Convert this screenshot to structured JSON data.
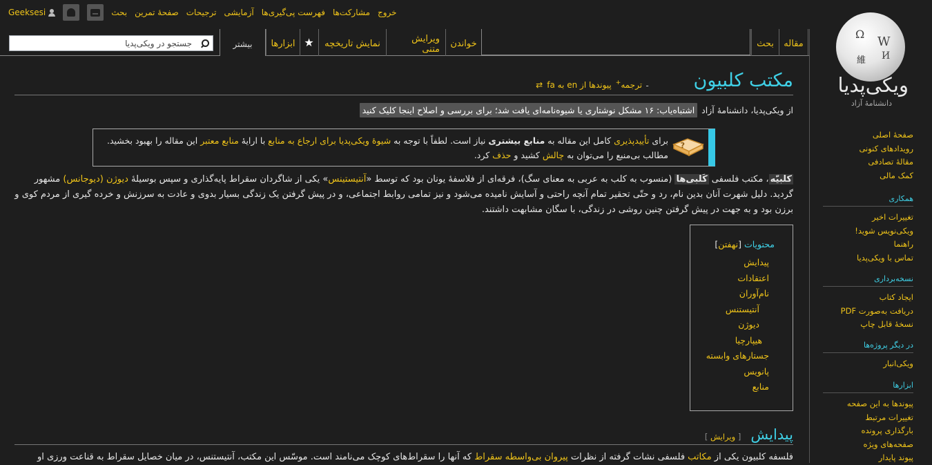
{
  "personal_tools": {
    "username": "Geeksesi",
    "talk": "بحث",
    "sandbox": "صفحهٔ تمرین",
    "preferences": "ترجیحات",
    "beta": "آزمایشی",
    "watchlist": "فهرست پی‌گیری‌ها",
    "contributions": "مشارکت‌ها",
    "logout": "خروج"
  },
  "search": {
    "placeholder": "جستجو در ویکی‌پدیا"
  },
  "tabs": {
    "article": "مقاله",
    "talk": "بحث",
    "read": "خواندن",
    "edit_source": "ویرایش متنی",
    "history": "نمایش تاریخچه",
    "watch_star": "★",
    "tools": "ابزارها",
    "more": "بیشتر"
  },
  "logo": {
    "wordmark": "ویکی‌پدیا",
    "tagline": "دانشنامهٔ آزاد"
  },
  "sidebar": {
    "navigation": [
      "صفحهٔ اصلی",
      "رویدادهای کنونی",
      "مقالهٔ تصادفی",
      "کمک مالی"
    ],
    "interaction": {
      "heading": "همکاری",
      "items": [
        "تغییرات اخیر",
        "ویکی‌نویس شوید!",
        "راهنما",
        "تماس با ویکی‌پدیا"
      ]
    },
    "print": {
      "heading": "نسخه‌برداری",
      "items": [
        "ایجاد کتاب",
        "دریافت به‌صورت PDF",
        "نسخهٔ قابل چاپ"
      ]
    },
    "projects": {
      "heading": "در دیگر پروژه‌ها",
      "items": [
        "ویکی‌انبار"
      ]
    },
    "tools": {
      "heading": "ابزارها",
      "items": [
        "پیوندها به این صفحه",
        "تغییرات مرتبط",
        "بارگذاری پرونده",
        "صفحه‌های ویژه",
        "پیوند پایدار"
      ]
    }
  },
  "article": {
    "title": "مکتب کلبیون",
    "translate": "ترجمه",
    "translate_sup": "+",
    "caret": "ـ",
    "lang_links": "پیوندها از en به fa",
    "lang_icon": "⇄",
    "site_sub": "از ویکی‌پدیا، دانشنامهٔ آزاد",
    "lint_notice": "اشتباه‌یاب: ۱۶ مشکل نوشتاری یا شیوه‌نامه‌ای یافت شد؛ برای بررسی و اصلاح اینجا کلیک کنید",
    "ambox": {
      "t1": "برای ",
      "l1": "تأییدپذیری",
      "t2": " کامل این مقاله به ",
      "b1": "منابع بیشتری",
      "t3": " نیاز است. لطفاً با توجه به ",
      "l2": "شیوهٔ ویکی‌پدیا برای ارجاع به منابع",
      "t4": " با ارایهٔ ",
      "l3": "منابع معتبر",
      "t5": " این مقاله را بهبود بخشید. مطالب بی‌منبع را می‌توان به ",
      "l4": "چالش",
      "t6": " کشید و ",
      "l5": "حذف",
      "t7": " کرد."
    },
    "lead": {
      "b1": "کلبیّه",
      "t1": "، مکتب فلسفی ",
      "b2": "کَلبی‌ها",
      "t2": " (منسوب به کلب به عربی به معنای سگ)، فرقه‌ای از فلاسفهٔ یونان بود که توسط «",
      "l1": "آنتیستینس",
      "t3": "» یکی از شاگردان سقراط پایه‌گذاری و سپس بوسیلهٔ ",
      "l2": "دیوژن (دیوجانس)",
      "t4": " مشهور گردید. دلیل شهرت آنان بدین نام، رد و حتّی تحقیر تمام آنچه راحتی و آسایش نامیده می‌شود و نیز تمامی روابط اجتماعی، و در پیش گرفتن یک زندگی بسیار بدوی و عادت به سرزنش و خرده گیری از مردم کوی و برزن بود و به جهت در پیش گرفتن چنین روشی در زندگی، با سگان مشابهت داشتند."
    },
    "toc": {
      "title": "محتویات",
      "toggle": "نهفتن",
      "bracket_open": "[",
      "bracket_close": "]",
      "items": [
        "پیدایش",
        "اعتقادات",
        "نام‌آوران",
        "آنتیستنس",
        "دیوژن",
        "هیپارچیا",
        "جستارهای وابسته",
        "پانویس",
        "منابع"
      ]
    },
    "section1": {
      "title": "پیدایش",
      "edit_open": "[",
      "edit": "ویرایش",
      "edit_close": "]",
      "t1": "فلسفه کلبیون یکی از ",
      "l1": "مکاتب",
      "t2": " فلسفی نشات گرفته از نظرات ",
      "l2": "پیروان بی‌واسطه سقراط",
      "t3": " که آنها را سقراط‌های کوچک می‌نامند است. موسّس این مکتب، آنتیستنس، در میان خصایل سقراط به قناعت ورزی او"
    }
  },
  "colors": {
    "background": "#1e1e1e",
    "link": "#f0c419",
    "heading": "#3fd0e6",
    "ambox_bar": "#36c8e6"
  }
}
